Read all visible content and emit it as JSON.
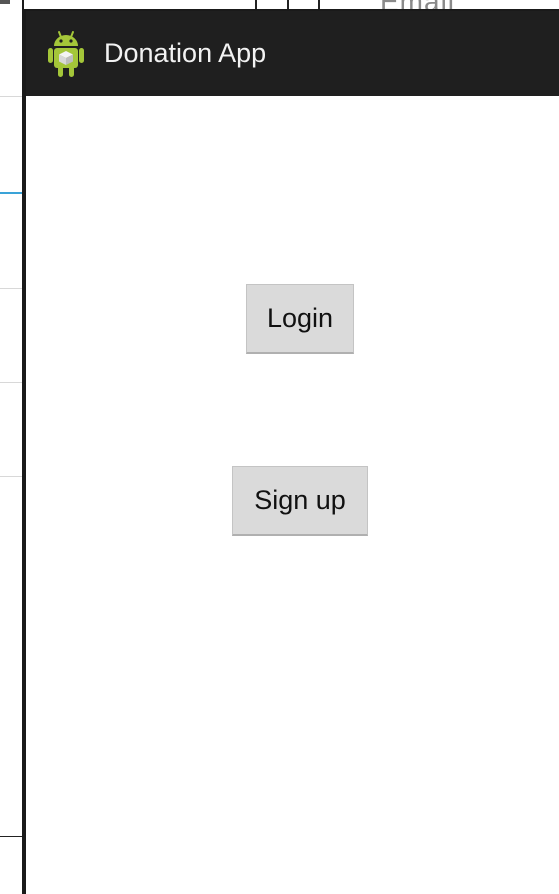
{
  "background": {
    "partial_text": "Email"
  },
  "app": {
    "title": "Donation App",
    "icon": "android-robot-icon"
  },
  "buttons": {
    "login_label": "Login",
    "signup_label": "Sign up"
  },
  "colors": {
    "action_bar": "#1f1f1f",
    "button_bg": "#dadada",
    "accent_line": "#3aa3d8",
    "android_green": "#a4c639"
  }
}
